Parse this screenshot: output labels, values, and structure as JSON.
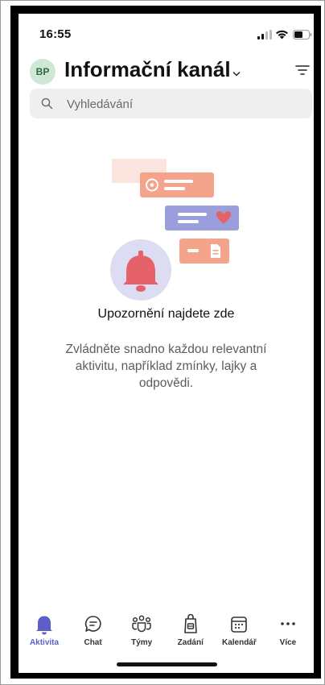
{
  "status_bar": {
    "time": "16:55",
    "icons": [
      "signal-icon",
      "wifi-icon",
      "battery-icon"
    ]
  },
  "header": {
    "avatar_initials": "BP",
    "title": "Informační kanál",
    "dropdown_icon": "chevron-down-icon",
    "filter_icon": "filter-icon"
  },
  "search": {
    "placeholder": "Vyhledávání",
    "value": ""
  },
  "empty_state": {
    "illustration": "notifications-illustration",
    "title": "Upozornění najdete zde",
    "description": "Zvládněte snadno každou relevantní aktivitu, například zmínky, lajky a odpovědi."
  },
  "nav": {
    "items": [
      {
        "label": "Aktivita",
        "icon": "bell-icon",
        "active": true
      },
      {
        "label": "Chat",
        "icon": "chat-icon",
        "active": false
      },
      {
        "label": "Týmy",
        "icon": "teams-icon",
        "active": false
      },
      {
        "label": "Zadání",
        "icon": "assignments-icon",
        "active": false
      },
      {
        "label": "Kalendář",
        "icon": "calendar-icon",
        "active": false
      },
      {
        "label": "Více",
        "icon": "more-icon",
        "active": false
      }
    ]
  },
  "colors": {
    "accent": "#5b5fc7",
    "avatar_bg": "#cfe8d6",
    "illustration_salmon": "#f4a38a",
    "illustration_purple": "#9a9fdc",
    "illustration_bell": "#e6626a"
  }
}
